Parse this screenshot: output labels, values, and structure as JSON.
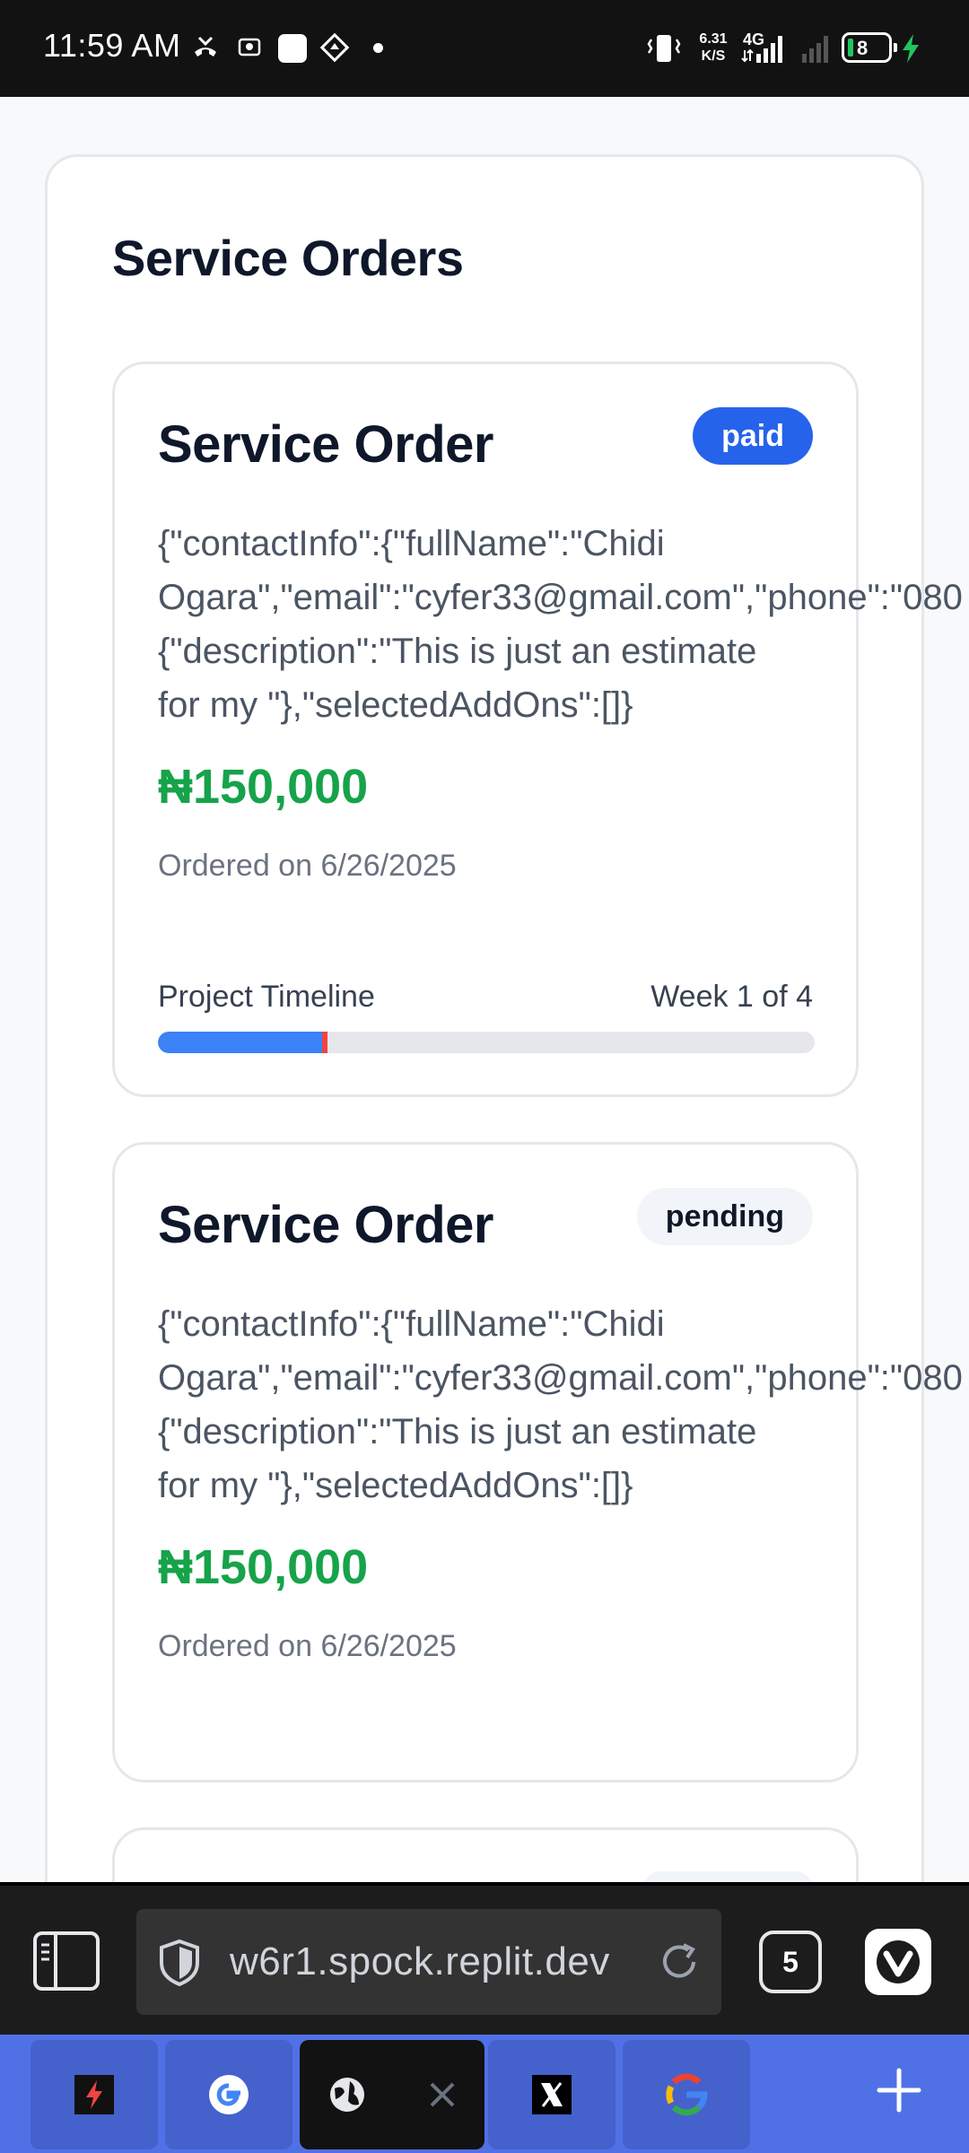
{
  "status_bar": {
    "time": "11:59 AM",
    "network_speed_value": "6.31",
    "network_speed_unit": "K/S",
    "network_type": "4G",
    "battery_level": "8",
    "icons": [
      "missed-call-icon",
      "screenshot-icon",
      "app-icon",
      "location-icon",
      "dot-icon",
      "vibrate-icon",
      "signal-icon",
      "signal-weak-icon",
      "battery-icon",
      "charging-icon"
    ]
  },
  "page": {
    "title": "Service Orders"
  },
  "orders": [
    {
      "title": "Service Order",
      "status": "paid",
      "details_line1": "{\"contactInfo\":{\"fullName\":\"Chidi",
      "details_line2": "Ogara\",\"email\":\"cyfer33@gmail.com\",\"phone\":\"080",
      "details_line3": "{\"description\":\"This is just an estimate",
      "details_line4": "for my \"},\"selectedAddOns\":[]}",
      "price": "₦150,000",
      "ordered_on": "Ordered on 6/26/2025",
      "timeline_label": "Project Timeline",
      "timeline_week": "Week 1 of 4",
      "timeline_progress": 0.25
    },
    {
      "title": "Service Order",
      "status": "pending",
      "details_line1": "{\"contactInfo\":{\"fullName\":\"Chidi",
      "details_line2": "Ogara\",\"email\":\"cyfer33@gmail.com\",\"phone\":\"080",
      "details_line3": "{\"description\":\"This is just an estimate",
      "details_line4": "for my \"},\"selectedAddOns\":[]}",
      "price": "₦150,000",
      "ordered_on": "Ordered on 6/26/2025"
    }
  ],
  "browser": {
    "url": "w6r1.spock.replit.dev",
    "tab_count": "5"
  },
  "tab_bar": {
    "tabs": [
      "bolt-app-icon",
      "google-icon",
      "globe-icon",
      "x-icon",
      "google-icon"
    ]
  },
  "colors": {
    "paid_badge": "#2563eb",
    "price_green": "#16a34a",
    "progress_blue": "#3b82f6",
    "tab_bar_blue": "#5071e6"
  }
}
